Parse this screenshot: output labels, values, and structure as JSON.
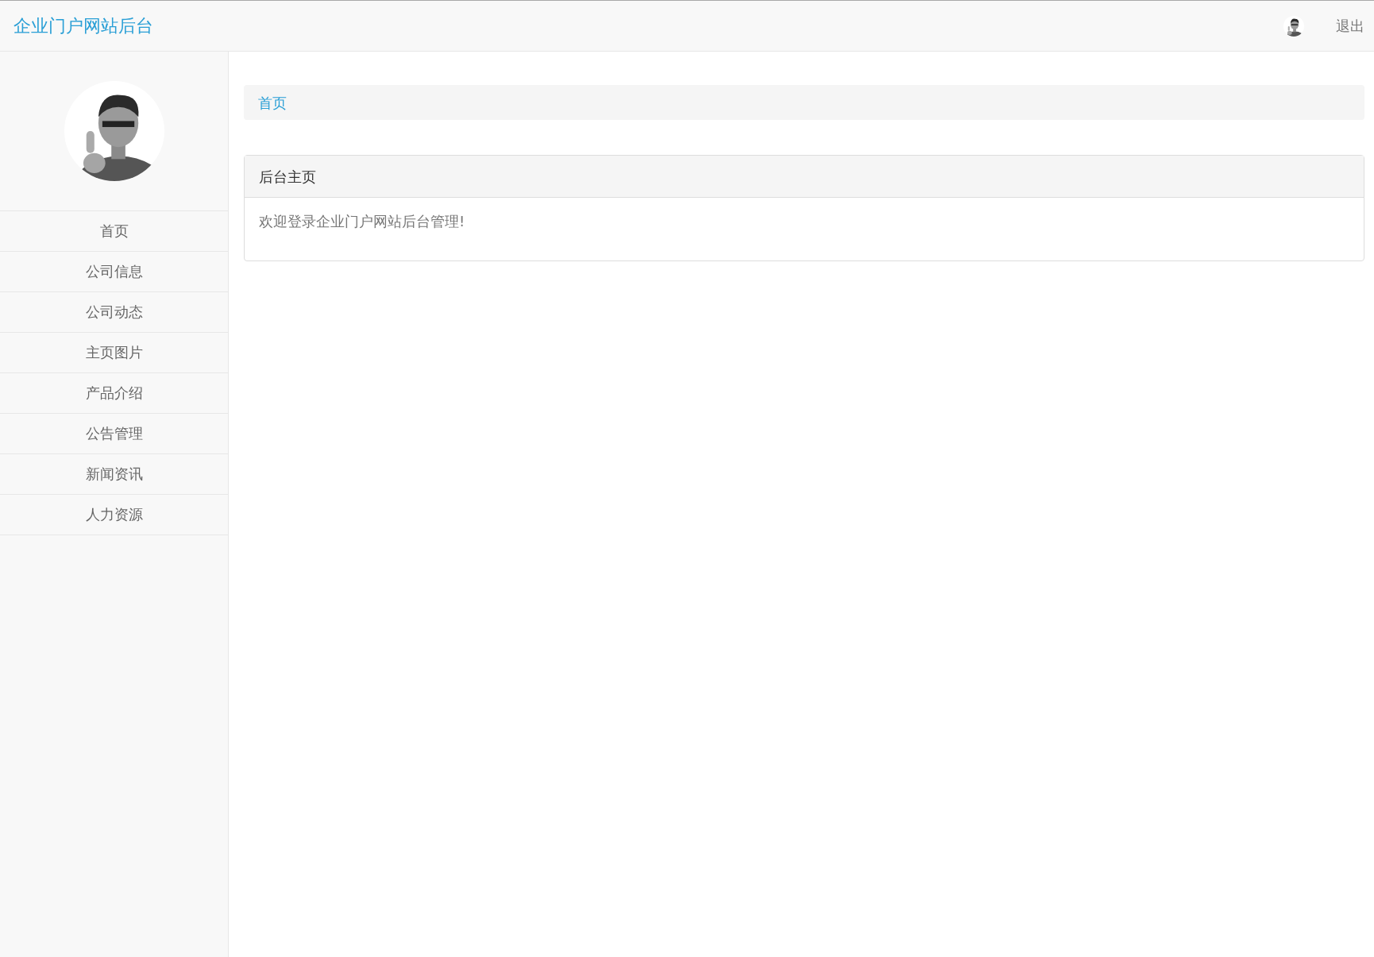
{
  "navbar": {
    "brand": "企业门户网站后台",
    "logout": "退出"
  },
  "sidebar": {
    "items": [
      {
        "label": "首页"
      },
      {
        "label": "公司信息"
      },
      {
        "label": "公司动态"
      },
      {
        "label": "主页图片"
      },
      {
        "label": "产品介绍"
      },
      {
        "label": "公告管理"
      },
      {
        "label": "新闻资讯"
      },
      {
        "label": "人力资源"
      }
    ]
  },
  "breadcrumb": [
    "首页"
  ],
  "panel": {
    "heading": "后台主页",
    "body": "欢迎登录企业门户网站后台管理!"
  }
}
